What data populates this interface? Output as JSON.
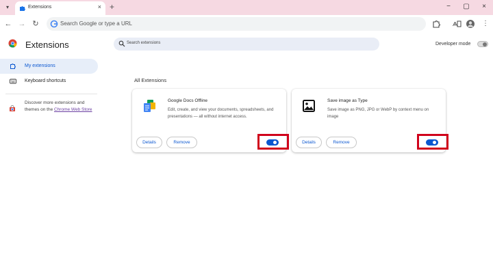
{
  "browser": {
    "tab_title": "Extensions",
    "new_tab_symbol": "+",
    "close_symbol": "×",
    "minimize_symbol": "−",
    "maximize_symbol": "▢",
    "window_close_symbol": "×",
    "omnibox_placeholder": "Search Google or type a URL"
  },
  "header": {
    "title": "Extensions",
    "search_placeholder": "Search extensions",
    "developer_mode_label": "Developer mode",
    "developer_mode_on": false
  },
  "sidebar": {
    "items": [
      {
        "label": "My extensions",
        "active": true
      },
      {
        "label": "Keyboard shortcuts",
        "active": false
      }
    ],
    "store_text": "Discover more extensions and themes on the ",
    "store_link": "Chrome Web Store"
  },
  "main": {
    "section_title": "All Extensions",
    "cards": [
      {
        "name": "Google Docs Offline",
        "description": "Edit, create, and view your documents, spreadsheets, and presentations — all without internet access.",
        "details_label": "Details",
        "remove_label": "Remove",
        "enabled": true
      },
      {
        "name": "Save image as Type",
        "description": "Save image as PNG, JPG or WebP by context menu on image",
        "details_label": "Details",
        "remove_label": "Remove",
        "enabled": true
      }
    ]
  },
  "colors": {
    "tabstrip": "#f6d9e2",
    "accent": "#0b57d0",
    "highlight": "#d0021b"
  }
}
